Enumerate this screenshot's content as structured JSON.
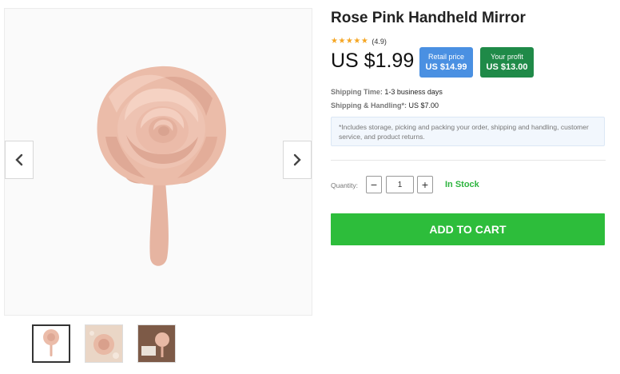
{
  "product": {
    "title": "Rose Pink Handheld Mirror",
    "rating_stars": "★★★★★",
    "rating_value": "(4.9)",
    "price": "US $1.99"
  },
  "badges": {
    "retail_label": "Retail price",
    "retail_value": "US $14.99",
    "profit_label": "Your profit",
    "profit_value": "US $13.00"
  },
  "shipping": {
    "time_label": "Shipping Time:",
    "time_value": "1-3 business days",
    "handling_label": "Shipping & Handling*:",
    "handling_value": "US $7.00"
  },
  "note": "*Includes storage, picking and packing your order, shipping and handling, customer service, and product returns.",
  "quantity": {
    "label": "Quantity:",
    "minus": "−",
    "plus": "+",
    "value": "1",
    "stock": "In Stock"
  },
  "cart": {
    "label": "ADD TO CART"
  },
  "colors": {
    "accent_green": "#2dbd3b",
    "retail_blue": "#4a90e2",
    "profit_green": "#1f8a48",
    "mirror_pink": "#e8b9a5"
  },
  "icons": {
    "prev": "chevron-left-icon",
    "next": "chevron-right-icon",
    "rating": "star-icon"
  },
  "thumbnails": [
    {
      "name": "thumb-mirror-white"
    },
    {
      "name": "thumb-mirror-beige"
    },
    {
      "name": "thumb-mirror-brown"
    }
  ]
}
